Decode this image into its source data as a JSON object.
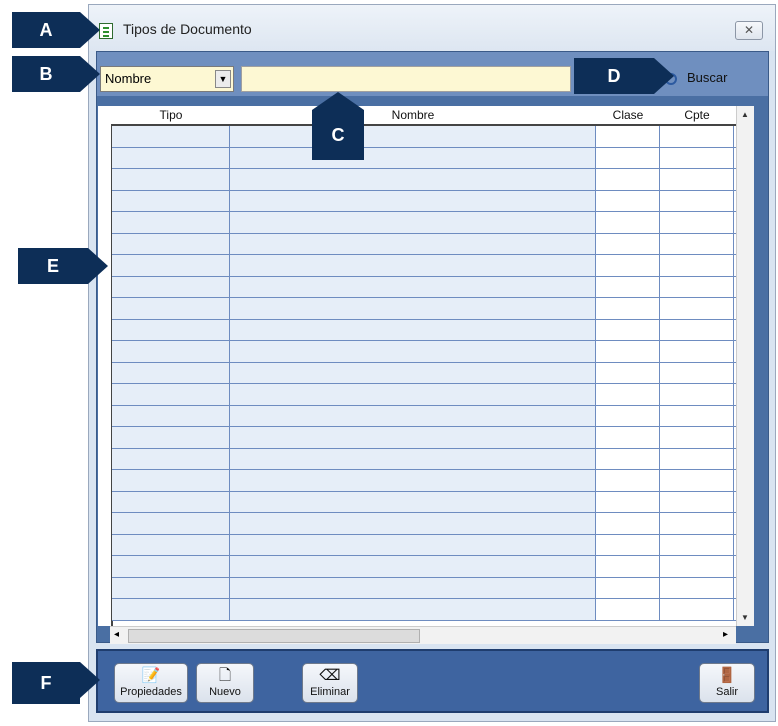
{
  "window": {
    "title": "Tipos de Documento",
    "close_icon": "close-icon"
  },
  "search": {
    "field_selected": "Nombre",
    "input_value": "",
    "button_label": "Buscar"
  },
  "grid": {
    "columns": [
      "Tipo",
      "Nombre",
      "Clase",
      "Cpte"
    ],
    "rows": []
  },
  "toolbar": {
    "propiedades_label": "Propiedades",
    "nuevo_label": "Nuevo",
    "eliminar_label": "Eliminar",
    "salir_label": "Salir"
  },
  "callouts": {
    "a": "A",
    "b": "B",
    "c": "C",
    "d": "D",
    "e": "E",
    "f": "F"
  },
  "colors": {
    "callout_bg": "#0d2e57",
    "panel_bg": "#4a6fa3",
    "input_bg": "#fdf8d3",
    "row_bg": "#e6eef8"
  }
}
